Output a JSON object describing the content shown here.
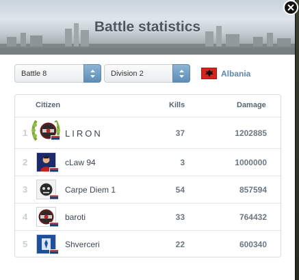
{
  "dialog": {
    "title": "Battle statistics"
  },
  "filters": {
    "battle": "Battle 8",
    "division": "Division 2",
    "country": "Albania"
  },
  "table": {
    "columns": {
      "citizen": "Citizen",
      "kills": "Kills",
      "damage": "Damage"
    },
    "rows": [
      {
        "rank": "1",
        "name": "LIRON",
        "kills": "37",
        "damage": "1202885",
        "highlight": true
      },
      {
        "rank": "2",
        "name": "cLaw 94",
        "kills": "3",
        "damage": "1000000"
      },
      {
        "rank": "3",
        "name": "Carpe Diem 1",
        "kills": "54",
        "damage": "857594"
      },
      {
        "rank": "4",
        "name": "baroti",
        "kills": "33",
        "damage": "764432"
      },
      {
        "rank": "5",
        "name": "Shverceri",
        "kills": "22",
        "damage": "600340"
      }
    ]
  },
  "colors": {
    "accent": "#5c87ad",
    "header_text": "#4a5660",
    "albania_red": "#d7231d",
    "wreath_green": "#7aa73a"
  },
  "icons": {
    "close": "close-icon",
    "dropdown": "chevron-down-icon",
    "country_flag": "albania-flag-icon",
    "row_flag": "serbia-flag-icon"
  }
}
